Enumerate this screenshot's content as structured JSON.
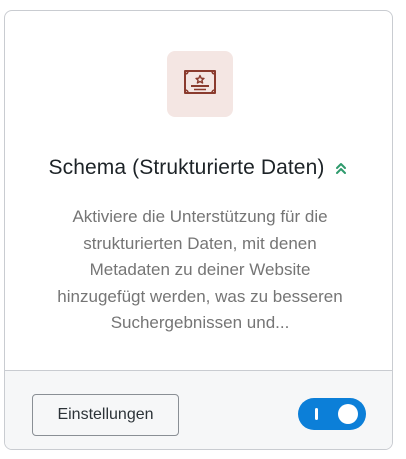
{
  "card": {
    "icon": "certificate-icon",
    "title": "Schema (Strukturierte Daten)",
    "pro_icon": "double-chevron-up-icon",
    "description": "Aktiviere die Unterstützung für die strukturierten Daten, mit denen Metadaten zu deiner Website hinzugefügt werden, was zu besseren Suchergebnissen und...",
    "settings_button_label": "Einstellungen",
    "toggle_state": "on"
  },
  "colors": {
    "accent": "#0c7fd8",
    "icon_tile_bg": "#f4e6e3",
    "icon_stroke": "#8a3b2e",
    "pro_icon": "#2e9a6c"
  }
}
